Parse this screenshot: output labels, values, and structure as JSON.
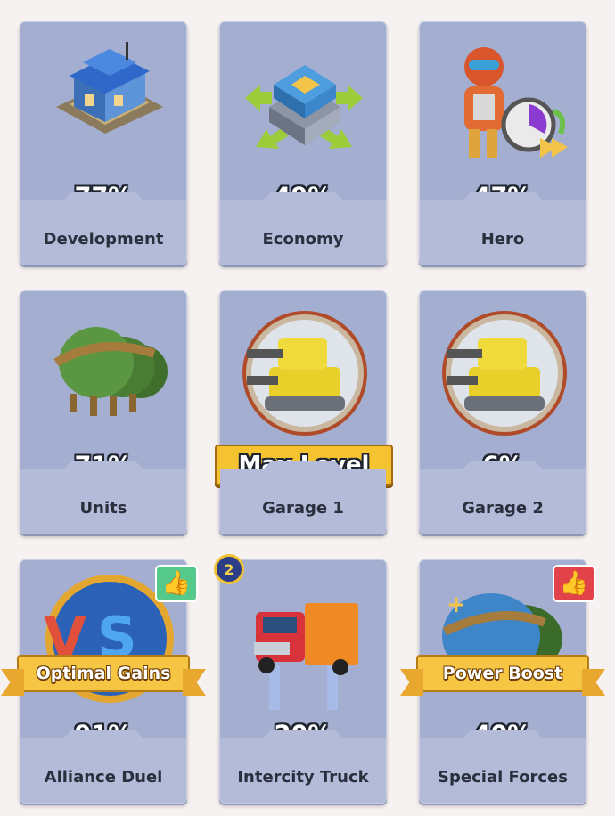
{
  "cards": [
    {
      "label": "Development",
      "percent": "77%",
      "icon": "house-icon"
    },
    {
      "label": "Economy",
      "percent": "49%",
      "icon": "headquarters-icon"
    },
    {
      "label": "Hero",
      "percent": "47%",
      "icon": "hero-clock-icon"
    },
    {
      "label": "Units",
      "percent": "71%",
      "icon": "helmet-stack-icon"
    },
    {
      "label": "Garage 1",
      "percent": "",
      "icon": "tank-icon",
      "ribbon": "Max Level"
    },
    {
      "label": "Garage 2",
      "percent": "6%",
      "icon": "tank-icon"
    },
    {
      "label": "Alliance Duel",
      "percent": "91%",
      "icon": "vs-icon",
      "ribbon": "Optimal Gains",
      "thumb": "thumbs-up-green"
    },
    {
      "label": "Intercity Truck",
      "percent": "20%",
      "icon": "truck-icon",
      "badge": "2"
    },
    {
      "label": "Special Forces",
      "percent": "40%",
      "icon": "helmet-icon",
      "ribbon": "Power Boost",
      "thumb": "thumbs-up-red"
    }
  ],
  "colors": {
    "card": "#a4aed0",
    "ribbon": "#f6c543",
    "thumb_green": "#55c98a",
    "thumb_red": "#e2434a",
    "badge": "#2c3e88"
  }
}
